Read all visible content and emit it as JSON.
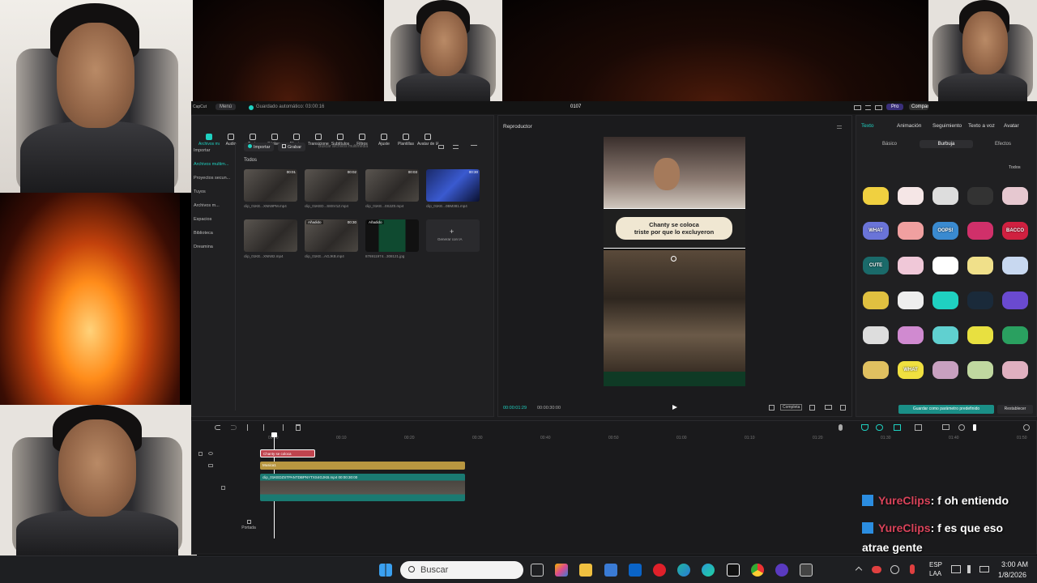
{
  "titlebar": {
    "app_menu": "Menú",
    "app_name": "CapCut",
    "autosave": "Guardado automático: 03:00:16",
    "project": "0107",
    "pro_label": "Pro",
    "share_label": "Compartir"
  },
  "toolbar": [
    {
      "label": "Archivos multimedia",
      "icon": "media-icon"
    },
    {
      "label": "Audio",
      "icon": "audio-icon"
    },
    {
      "label": "Texto",
      "icon": "text-icon"
    },
    {
      "label": "Stickers",
      "icon": "stickers-icon"
    },
    {
      "label": "Efectos",
      "icon": "effects-icon"
    },
    {
      "label": "Transiciones",
      "icon": "transitions-icon"
    },
    {
      "label": "Subtítulos",
      "icon": "subtitles-icon"
    },
    {
      "label": "Filtros",
      "icon": "filters-icon"
    },
    {
      "label": "Ajuste",
      "icon": "adjust-icon"
    },
    {
      "label": "Plantillas",
      "icon": "templates-icon"
    },
    {
      "label": "Avatar de IA",
      "icon": "avatar-icon"
    }
  ],
  "sidebar": [
    {
      "label": "Importar"
    },
    {
      "label": "Archivos multim..."
    },
    {
      "label": "Proyectos secun..."
    },
    {
      "label": "Tuyos"
    },
    {
      "label": "Archivos m..."
    },
    {
      "label": "Espacios"
    },
    {
      "label": "Biblioteca"
    },
    {
      "label": "Dreamina"
    }
  ],
  "media": {
    "import_button": "Importar",
    "record_button": "Grabar",
    "search_placeholder": "Buscar archivos multimedia",
    "filter_label": "Todos",
    "items": [
      {
        "name": "clip_01KE...XNN9PM.mp4",
        "duration": "00:01"
      },
      {
        "name": "clip_01KED...S8SV1Z.mp4",
        "duration": "00:02"
      },
      {
        "name": "clip_01KE...0S2Z0.mp4",
        "duration": "00:03"
      },
      {
        "name": "clip_01KE...0BM381.mp4",
        "duration": "00:30"
      },
      {
        "name": "clip_01KE...XNN82.mp4",
        "duration": ""
      },
      {
        "name": "clip_01KE...AGJKB.mp4",
        "duration": "00:30",
        "badge": "Añadido"
      },
      {
        "name": "876911974...308121.jpg",
        "duration": "",
        "badge": "Añadido"
      },
      {
        "name": "Generar con IA",
        "duration": ""
      }
    ]
  },
  "player": {
    "title": "Reproductor",
    "current_time": "00:00:01:29",
    "total_time": "00:00:30:00",
    "ratio_label": "Completa",
    "caption_line1": "Chanty se coloca",
    "caption_line2": "triste por que lo excluyeron"
  },
  "right_panel": {
    "tabs": [
      "Texto",
      "Animación",
      "Seguimiento",
      "Texto a voz",
      "Avatar"
    ],
    "subtabs": [
      "Básico",
      "Burbuja",
      "Efectos"
    ],
    "filter_label": "Todos",
    "save_default_button": "Guardar como parámetro predefinido",
    "reset_button": "Restablecer",
    "sticker_texts": [
      "WHAT",
      "CUTE",
      "OOPS!",
      "BACCO",
      "WHAT"
    ]
  },
  "timeline": {
    "ticks": [
      "00:00",
      "00:10",
      "00:20",
      "00:30",
      "00:40",
      "00:50",
      "01:00",
      "01:10",
      "01:20",
      "01:30",
      "01:40",
      "01:50"
    ],
    "text_clip": "Chanty se coloca",
    "audio_clip": "Musica1",
    "video_clip": "clip_01KEDZSTPANTDBPNYTXS4GJKB.mp4  00:00:30:00",
    "cover_label": "Portada"
  },
  "chat": [
    {
      "user": "YureClips",
      "message": ": f oh entiendo"
    },
    {
      "user": "YureClips",
      "message": ": f es que eso atrae gente"
    }
  ],
  "taskbar": {
    "search_placeholder": "Buscar",
    "lang": "ESP",
    "layout": "LAA",
    "time": "3:00 AM",
    "date": "1/8/2026"
  },
  "colors": {
    "accent": "#1fd1c1",
    "chat_user": "#d9435a",
    "timeline_text": "#c0444e",
    "timeline_audio": "#b89640",
    "timeline_video": "#1a7a72"
  }
}
